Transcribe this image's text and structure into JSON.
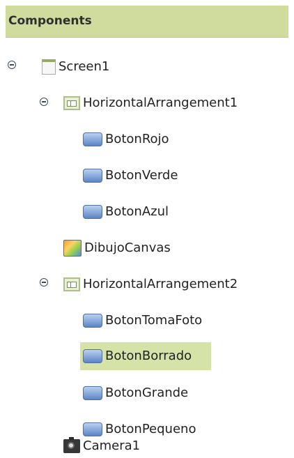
{
  "panel": {
    "title": "Components"
  },
  "tree": {
    "items": [
      {
        "label": "Screen1",
        "type": "screen",
        "expanded": true,
        "toggle_symbol": "minus"
      },
      {
        "label": "HorizontalArrangement1",
        "type": "horizontal-arrangement",
        "expanded": true,
        "toggle_symbol": "minus"
      },
      {
        "label": "BotonRojo",
        "type": "button"
      },
      {
        "label": "BotonVerde",
        "type": "button"
      },
      {
        "label": "BotonAzul",
        "type": "button"
      },
      {
        "label": "DibujoCanvas",
        "type": "canvas"
      },
      {
        "label": "HorizontalArrangement2",
        "type": "horizontal-arrangement",
        "expanded": true,
        "toggle_symbol": "minus"
      },
      {
        "label": "BotonTomaFoto",
        "type": "button"
      },
      {
        "label": "BotonBorrado",
        "type": "button",
        "selected": true
      },
      {
        "label": "BotonGrande",
        "type": "button"
      },
      {
        "label": "BotonPequeno",
        "type": "button"
      },
      {
        "label": "Camera1",
        "type": "camera"
      }
    ]
  },
  "colors": {
    "header_background": "#cfdc9e",
    "selected_background": "#d5e3a8",
    "text": "#222222"
  }
}
